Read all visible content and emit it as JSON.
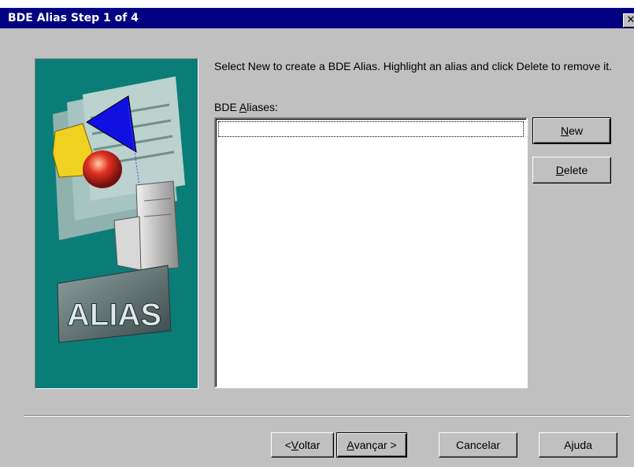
{
  "window": {
    "title": "BDE Alias Step 1 of 4",
    "close_glyph": "✕"
  },
  "side_image": {
    "logo_text": "ALIAS"
  },
  "instructions": {
    "text": "Select New to create a BDE Alias. Highlight an alias and click Delete to remove it."
  },
  "aliases": {
    "label_prefix": "BDE ",
    "label_accel": "A",
    "label_rest": "liases:",
    "items": []
  },
  "buttons": {
    "new_accel": "N",
    "new_rest": "ew",
    "delete_accel": "D",
    "delete_rest": "elete",
    "back_prefix": "< ",
    "back_accel": "V",
    "back_rest": "oltar",
    "next_accel": "A",
    "next_rest": "vançar >",
    "cancel": "Cancelar",
    "help": "Ajuda"
  },
  "colors": {
    "titlebar": "#000080",
    "dialog": "#c0c0c0",
    "panel": "#0b7d79"
  }
}
